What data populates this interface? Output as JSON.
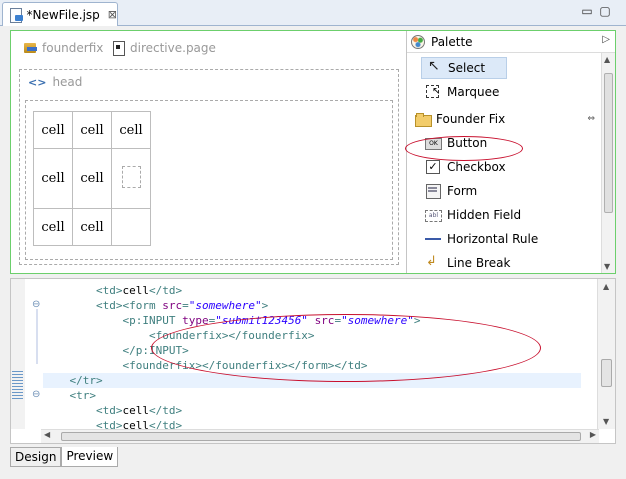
{
  "editor_tab": {
    "title": "*NewFile.jsp",
    "close_glyph": "⊠"
  },
  "window_controls": {
    "minimize": "▭",
    "maximize": "▢"
  },
  "canvas": {
    "items": [
      {
        "label": "founderfix",
        "icon": "founderfix-tag-icon"
      },
      {
        "label": "directive.page",
        "icon": "directive-icon"
      }
    ],
    "head_label": "head",
    "table": [
      [
        "cell",
        "cell",
        "cell"
      ],
      [
        "cell",
        "cell",
        ""
      ],
      [
        "cell",
        "cell",
        ""
      ]
    ]
  },
  "palette": {
    "title": "Palette",
    "tools": [
      {
        "label": "Select",
        "icon": "select-arrow-icon",
        "selected": true
      },
      {
        "label": "Marquee",
        "icon": "marquee-icon",
        "selected": false
      }
    ],
    "drawer": {
      "label": "Founder Fix",
      "icon": "folder-open-icon",
      "pin": "⇔"
    },
    "components": [
      {
        "label": "Button",
        "icon": "button-icon"
      },
      {
        "label": "Checkbox",
        "icon": "checkbox-icon"
      },
      {
        "label": "Form",
        "icon": "form-icon"
      },
      {
        "label": "Hidden Field",
        "icon": "hidden-field-icon"
      },
      {
        "label": "Horizontal Rule",
        "icon": "horizontal-rule-icon"
      },
      {
        "label": "Line Break",
        "icon": "line-break-icon"
      }
    ]
  },
  "source": {
    "lines": [
      {
        "indent": "        ",
        "parts": [
          [
            "tag",
            "<td>"
          ],
          [
            "txt",
            "cell"
          ],
          [
            "tag",
            "</td>"
          ]
        ],
        "fold": false,
        "highlight": false
      },
      {
        "indent": "        ",
        "parts": [
          [
            "tag",
            "<td><form "
          ],
          [
            "attr",
            "src"
          ],
          [
            "tag",
            "="
          ],
          [
            "val",
            "\"somewhere\""
          ],
          [
            "tag",
            ">"
          ]
        ],
        "fold": true,
        "highlight": false
      },
      {
        "indent": "            ",
        "parts": [
          [
            "tag",
            "<p:INPUT "
          ],
          [
            "attr",
            "type"
          ],
          [
            "tag",
            "="
          ],
          [
            "val",
            "\"submit123456\""
          ],
          [
            "tag",
            " "
          ],
          [
            "attr",
            "src"
          ],
          [
            "tag",
            "="
          ],
          [
            "val",
            "\"somewhere\""
          ],
          [
            "tag",
            ">"
          ]
        ],
        "fold": false,
        "highlight": false
      },
      {
        "indent": "                ",
        "parts": [
          [
            "tag",
            "<founderfix></founderfix>"
          ]
        ],
        "fold": false,
        "highlight": false
      },
      {
        "indent": "            ",
        "parts": [
          [
            "tag",
            "</p:INPUT>"
          ]
        ],
        "fold": false,
        "highlight": false
      },
      {
        "indent": "            ",
        "parts": [
          [
            "tag",
            "<founderfix></founderfix></form></td>"
          ]
        ],
        "fold": false,
        "highlight": false
      },
      {
        "indent": "    ",
        "parts": [
          [
            "tag",
            "</tr>"
          ]
        ],
        "fold": false,
        "highlight": true
      },
      {
        "indent": "    ",
        "parts": [
          [
            "tag",
            "<tr>"
          ]
        ],
        "fold": true,
        "highlight": false
      },
      {
        "indent": "        ",
        "parts": [
          [
            "tag",
            "<td>"
          ],
          [
            "txt",
            "cell"
          ],
          [
            "tag",
            "</td>"
          ]
        ],
        "fold": false,
        "highlight": false
      },
      {
        "indent": "        ",
        "parts": [
          [
            "tag",
            "<td>"
          ],
          [
            "txt",
            "cell"
          ],
          [
            "tag",
            "</td>"
          ]
        ],
        "fold": false,
        "highlight": false
      }
    ]
  },
  "bottom_tabs": [
    {
      "label": "Design",
      "active": false
    },
    {
      "label": "Preview",
      "active": true
    }
  ],
  "colors": {
    "annotation_red": "#c8102e",
    "design_border": "#6ccf6c",
    "tag_color": "#3f7f7f",
    "attr_color": "#7f007f",
    "value_color": "#2a00ff"
  }
}
